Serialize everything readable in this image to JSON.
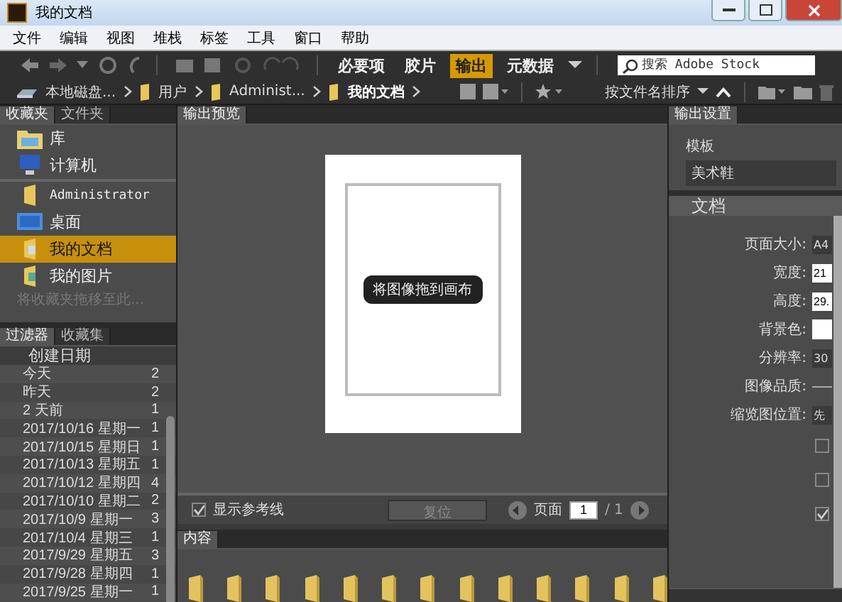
{
  "window": {
    "title": "我的文档"
  },
  "menu": [
    "文件",
    "编辑",
    "视图",
    "堆栈",
    "标签",
    "工具",
    "窗口",
    "帮助"
  ],
  "workspaces": [
    {
      "label": "必要项",
      "selected": false
    },
    {
      "label": "胶片",
      "selected": false
    },
    {
      "label": "输出",
      "selected": true
    },
    {
      "label": "元数据",
      "selected": false
    }
  ],
  "search": {
    "placeholder": "搜索 Adobe Stock"
  },
  "path": [
    "本地磁盘...",
    "用户",
    "Administ...",
    "我的文档"
  ],
  "sort": {
    "label": "按文件名排序"
  },
  "favorites": {
    "tabs": [
      {
        "label": "收藏夹",
        "selected": true
      },
      {
        "label": "文件夹",
        "selected": false
      }
    ],
    "items": [
      {
        "label": "库",
        "kind": "library",
        "selected": false
      },
      {
        "label": "计算机",
        "kind": "computer",
        "selected": false
      },
      {
        "label": "Administrator",
        "kind": "folder",
        "selected": false
      },
      {
        "label": "桌面",
        "kind": "desktop",
        "selected": false
      },
      {
        "label": "我的文档",
        "kind": "documents",
        "selected": true
      },
      {
        "label": "我的图片",
        "kind": "pictures",
        "selected": false
      }
    ],
    "hint": "将收藏夹拖移至此..."
  },
  "filter": {
    "tabs": [
      {
        "label": "过滤器",
        "selected": true
      },
      {
        "label": "收藏集",
        "selected": false
      }
    ],
    "heading": "创建日期",
    "rows": [
      {
        "label": "今天",
        "count": "2"
      },
      {
        "label": "昨天",
        "count": "2"
      },
      {
        "label": "2 天前",
        "count": "1"
      },
      {
        "label": "2017/10/16 星期一",
        "count": "1"
      },
      {
        "label": "2017/10/15 星期日",
        "count": "1"
      },
      {
        "label": "2017/10/13 星期五",
        "count": "1"
      },
      {
        "label": "2017/10/12 星期四",
        "count": "4"
      },
      {
        "label": "2017/10/10 星期二",
        "count": "2"
      },
      {
        "label": "2017/10/9 星期一",
        "count": "3"
      },
      {
        "label": "2017/10/4 星期三",
        "count": "1"
      },
      {
        "label": "2017/9/29 星期五",
        "count": "3"
      },
      {
        "label": "2017/9/28 星期四",
        "count": "1"
      },
      {
        "label": "2017/9/25 星期一",
        "count": "1"
      }
    ]
  },
  "preview": {
    "tab": "输出预览",
    "drop_label": "将图像拖到画布",
    "guides": {
      "label": "显示参考线",
      "checked": true
    },
    "reset": {
      "label": "复位",
      "disabled": true
    },
    "page_label": "页面",
    "page": "1",
    "page_total": "/ 1"
  },
  "content": {
    "tab": "内容"
  },
  "output": {
    "tab": "输出设置",
    "template_label": "模板",
    "template": "美术鞋",
    "section": "文档",
    "fields": [
      {
        "kind": "text",
        "label": "页面大小:",
        "value": "A4"
      },
      {
        "kind": "input",
        "label": "宽度:",
        "value": "21"
      },
      {
        "kind": "input",
        "label": "高度:",
        "value": "29."
      },
      {
        "kind": "swatch",
        "label": "背景色:"
      },
      {
        "kind": "text",
        "label": "分辨率:",
        "value": "30"
      },
      {
        "kind": "slider",
        "label": "图像品质:"
      },
      {
        "kind": "text",
        "label": "缩览图位置:",
        "value": "先"
      },
      {
        "kind": "check",
        "checked": false
      },
      {
        "kind": "check",
        "checked": false
      },
      {
        "kind": "check",
        "checked": true
      }
    ]
  }
}
